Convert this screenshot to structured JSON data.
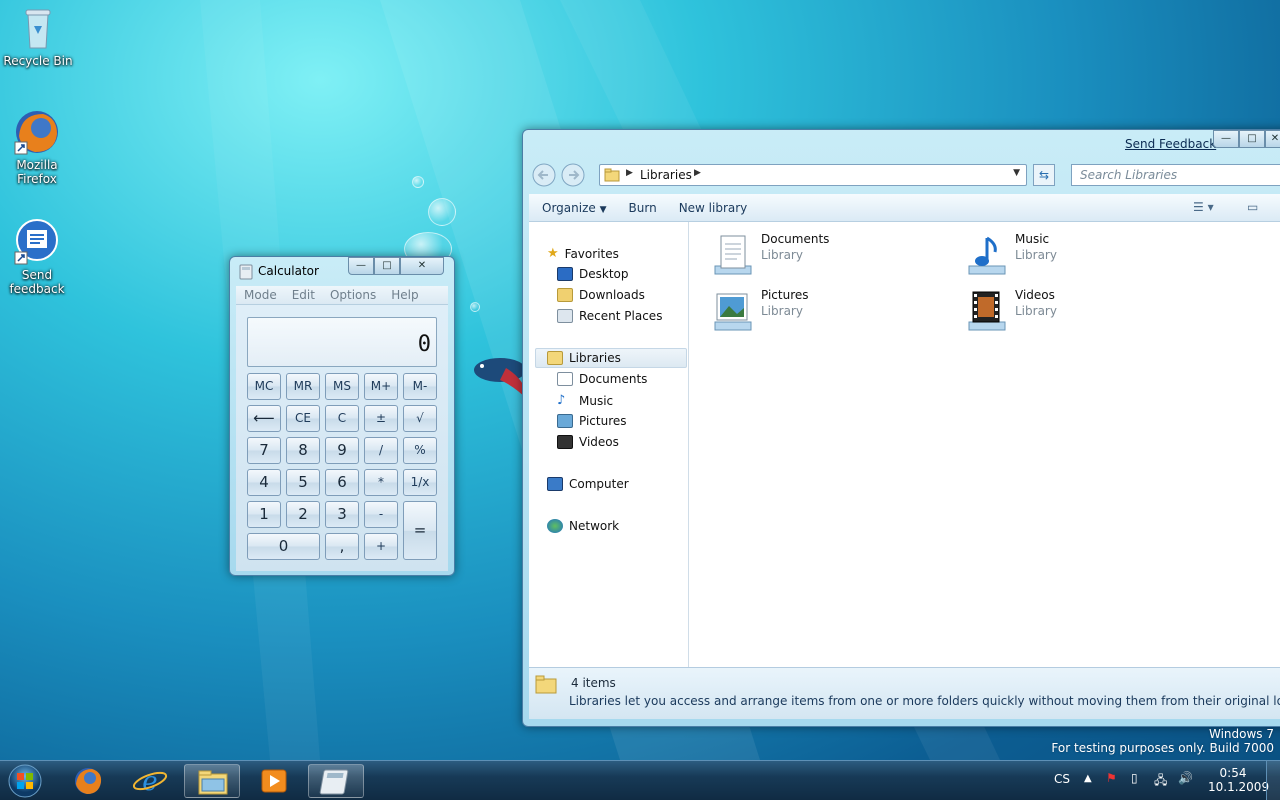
{
  "desktop": {
    "icons": [
      {
        "label": "Recycle Bin",
        "icon": "recycle-bin-icon"
      },
      {
        "label": "Mozilla Firefox",
        "icon": "firefox-icon"
      },
      {
        "label": "Send feedback",
        "icon": "feedback-icon"
      }
    ],
    "watermark": {
      "line1": "Windows 7",
      "line2": "For testing purposes only. Build 7000"
    }
  },
  "calculator": {
    "title": "Calculator",
    "menu": [
      "Mode",
      "Edit",
      "Options",
      "Help"
    ],
    "display": "0",
    "buttons": {
      "mc": "MC",
      "mr": "MR",
      "ms": "MS",
      "mplus": "M+",
      "mminus": "M-",
      "back": "⟵",
      "ce": "CE",
      "c": "C",
      "plusminus": "±",
      "sqrt": "√",
      "n7": "7",
      "n8": "8",
      "n9": "9",
      "div": "/",
      "pct": "%",
      "n4": "4",
      "n5": "5",
      "n6": "6",
      "mul": "*",
      "recip": "1/x",
      "n1": "1",
      "n2": "2",
      "n3": "3",
      "sub": "-",
      "eq": "=",
      "n0": "0",
      "dot": ",",
      "add": "+"
    }
  },
  "explorer": {
    "send_feedback": "Send Feedback",
    "address": "Libraries",
    "search_placeholder": "Search Libraries",
    "toolbar": {
      "organize": "Organize",
      "burn": "Burn",
      "new_library": "New library"
    },
    "nav": {
      "favorites": "Favorites",
      "favorites_items": [
        "Desktop",
        "Downloads",
        "Recent Places"
      ],
      "libraries": "Libraries",
      "libraries_items": [
        "Documents",
        "Music",
        "Pictures",
        "Videos"
      ],
      "computer": "Computer",
      "network": "Network"
    },
    "libraries": [
      {
        "name": "Documents",
        "type": "Library",
        "icon": "documents-library-icon"
      },
      {
        "name": "Music",
        "type": "Library",
        "icon": "music-library-icon"
      },
      {
        "name": "Pictures",
        "type": "Library",
        "icon": "pictures-library-icon"
      },
      {
        "name": "Videos",
        "type": "Library",
        "icon": "videos-library-icon"
      }
    ],
    "status": {
      "count": "4 items",
      "description": "Libraries let you access and arrange items from one or more folders quickly without moving them from their original locations."
    }
  },
  "taskbar": {
    "start_icon": "windows-start-icon",
    "pinned": [
      "firefox-icon",
      "internet-explorer-icon",
      "explorer-folder-icon",
      "media-player-icon",
      "calculator-icon"
    ],
    "language": "CS",
    "time": "0:54",
    "date": "10.1.2009"
  }
}
